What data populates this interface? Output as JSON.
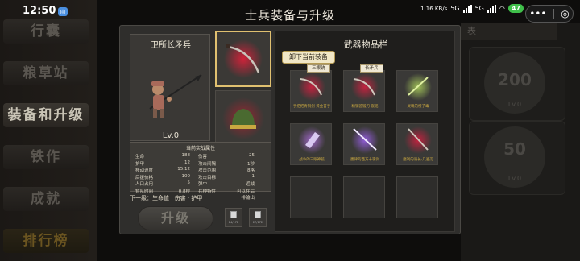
{
  "status_bar": {
    "time": "12:50",
    "speed": "1.16\nKB/s",
    "net1": "5G",
    "net2": "5G",
    "battery": "47",
    "capsule_menu": "•••",
    "capsule_close": "◎"
  },
  "page_title": "士兵装备与升级",
  "side_menu": [
    "行囊",
    "粮草站",
    "装备和升级",
    "铁作",
    "成就",
    "排行榜"
  ],
  "background": {
    "tab_text": "表",
    "card1_num": "200",
    "card1_sub": "Lv.0",
    "card2_num": "50",
    "card2_sub": "Lv.0"
  },
  "unit": {
    "name": "卫所长矛兵",
    "level": "Lv.0"
  },
  "stats": {
    "title": "当前实战属性",
    "rows": [
      [
        "生命",
        "188",
        "伤害",
        "25"
      ],
      [
        "护甲",
        "12",
        "攻击间隔",
        "1秒"
      ],
      [
        "移动速度",
        "15.12",
        "攻击范围",
        "8格"
      ],
      [
        "后援价格",
        "100",
        "攻击目标",
        "1"
      ],
      [
        "人口占用",
        "5",
        "弹中",
        "近战"
      ],
      [
        "暂队时间",
        "0.8秒",
        "兵种特性",
        "可以在后排输出"
      ]
    ]
  },
  "next_level": "下一级：生命值 · 伤害 · 护甲",
  "upgrade_button": "升级",
  "materials": [
    {
      "count": "24/172"
    },
    {
      "count": "27/172"
    }
  ],
  "inventory": {
    "title": "武器物品栏",
    "unequip_button": "卸下当前装备",
    "items": [
      {
        "label": "手把把青铜剑·黄金首手",
        "tag": "三眼铳",
        "color": "#d02040"
      },
      {
        "label": "精钢首锻刀·嵌铭",
        "tag": "长矛兵",
        "color": "#d02040"
      },
      {
        "label": "灵境的橙子毒",
        "tag": "",
        "color": "#b8e060"
      },
      {
        "label": "战争的三眼神铳",
        "tag": "",
        "color": "#b070e0"
      },
      {
        "label": "墨律的西方十字剑",
        "tag": "",
        "color": "#9a60e8"
      },
      {
        "label": "磨剃的骑长·几遍刃",
        "tag": "",
        "color": "#d02040"
      }
    ]
  },
  "colors": {
    "gold_border": "#e0c070",
    "legendary_red": "#d02040",
    "epic_purple": "#9a60e8",
    "rare_green": "#b8e060"
  }
}
